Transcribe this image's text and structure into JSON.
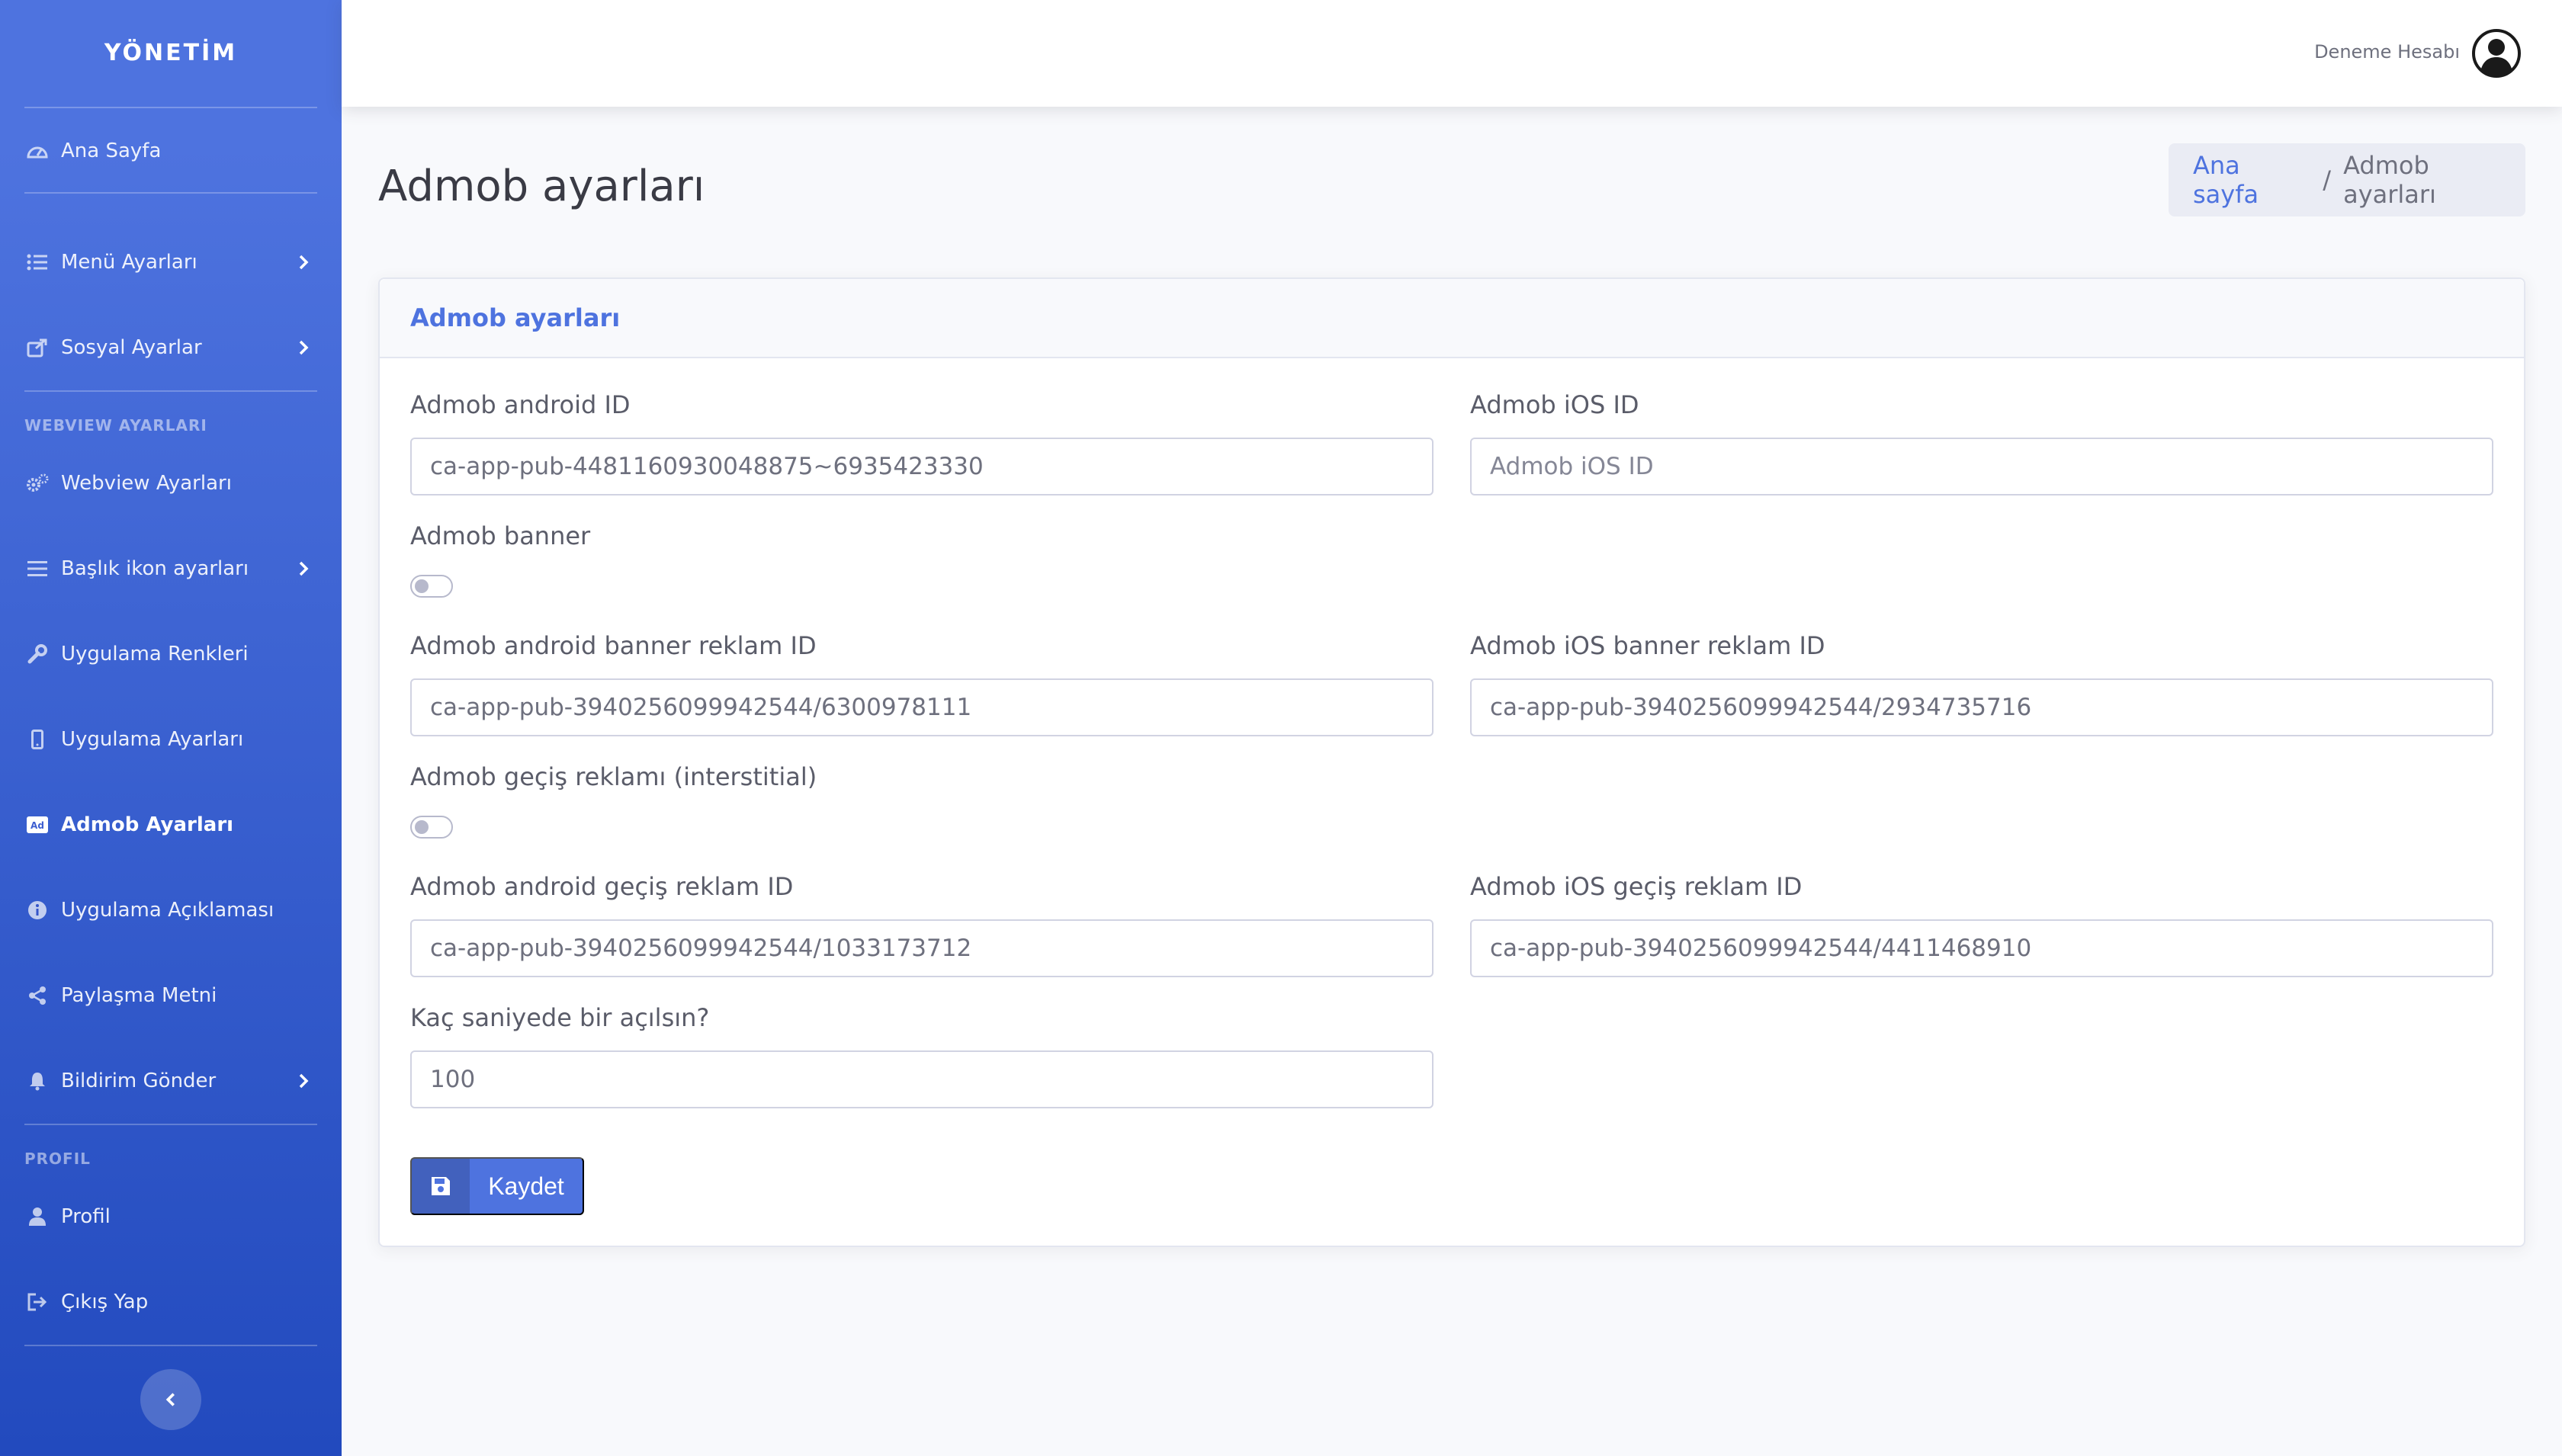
{
  "sidebar": {
    "brand": "YÖNETİM",
    "items": [
      {
        "label": "Ana Sayfa"
      },
      {
        "label": "Menü Ayarları"
      },
      {
        "label": "Sosyal Ayarlar"
      },
      {
        "label": "Webview Ayarları"
      },
      {
        "label": "Başlık ikon ayarları"
      },
      {
        "label": "Uygulama Renkleri"
      },
      {
        "label": "Uygulama Ayarları"
      },
      {
        "label": "Admob Ayarları"
      },
      {
        "label": "Uygulama Açıklaması"
      },
      {
        "label": "Paylaşma Metni"
      },
      {
        "label": "Bildirim Gönder"
      },
      {
        "label": "Profil"
      },
      {
        "label": "Çıkış Yap"
      }
    ],
    "headings": {
      "webview": "WEBVIEW AYARLARI",
      "profil": "PROFIL"
    }
  },
  "topbar": {
    "user_name": "Deneme Hesabı"
  },
  "page": {
    "title": "Admob ayarları",
    "breadcrumb": {
      "home": "Ana sayfa",
      "separator": "/",
      "current": "Admob ayarları"
    }
  },
  "form": {
    "card_title": "Admob ayarları",
    "android_id": {
      "label": "Admob android ID",
      "value": "ca-app-pub-4481160930048875~6935423330"
    },
    "ios_id": {
      "label": "Admob iOS ID",
      "value": "",
      "placeholder": "Admob iOS ID"
    },
    "banner_toggle": {
      "label": "Admob banner",
      "checked": false
    },
    "android_banner_id": {
      "label": "Admob android banner reklam ID",
      "value": "ca-app-pub-3940256099942544/6300978111"
    },
    "ios_banner_id": {
      "label": "Admob iOS banner reklam ID",
      "value": "ca-app-pub-3940256099942544/2934735716"
    },
    "interstitial_toggle": {
      "label": "Admob geçiş reklamı (interstitial)",
      "checked": false
    },
    "android_interstitial_id": {
      "label": "Admob android geçiş reklam ID",
      "value": "ca-app-pub-3940256099942544/1033173712"
    },
    "ios_interstitial_id": {
      "label": "Admob iOS geçiş reklam ID",
      "value": "ca-app-pub-3940256099942544/4411468910"
    },
    "interval": {
      "label": "Kaç saniyede bir açılsın?",
      "value": "100"
    },
    "save_label": "Kaydet"
  },
  "colors": {
    "primary": "#4e73df",
    "sidebar_end": "#224abe",
    "background": "#f8f9fc"
  }
}
